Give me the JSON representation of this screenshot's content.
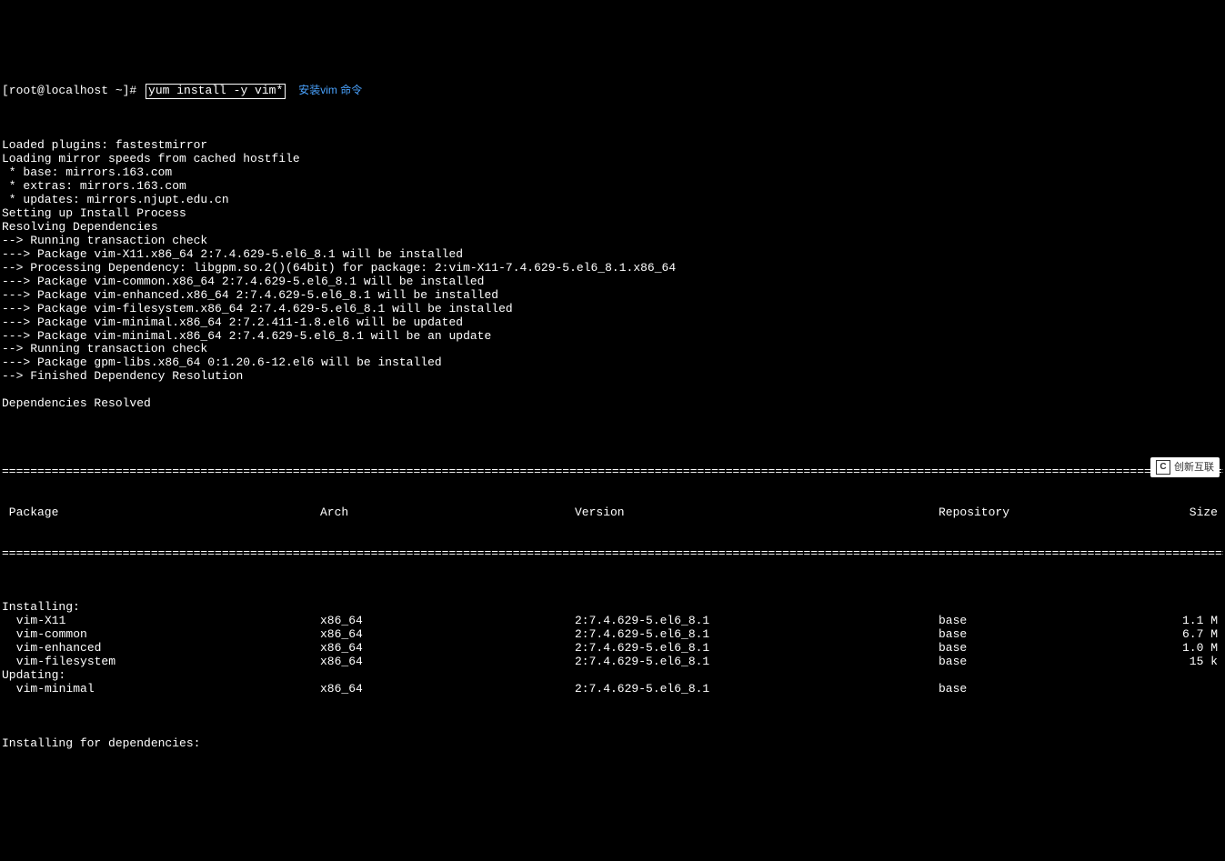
{
  "prompt": "[root@localhost ~]# ",
  "command": "yum install -y vim*",
  "annotation": "安装vim 命令",
  "output_lines": [
    "Loaded plugins: fastestmirror",
    "Loading mirror speeds from cached hostfile",
    " * base: mirrors.163.com",
    " * extras: mirrors.163.com",
    " * updates: mirrors.njupt.edu.cn",
    "Setting up Install Process",
    "Resolving Dependencies",
    "--> Running transaction check",
    "---> Package vim-X11.x86_64 2:7.4.629-5.el6_8.1 will be installed",
    "--> Processing Dependency: libgpm.so.2()(64bit) for package: 2:vim-X11-7.4.629-5.el6_8.1.x86_64",
    "---> Package vim-common.x86_64 2:7.4.629-5.el6_8.1 will be installed",
    "---> Package vim-enhanced.x86_64 2:7.4.629-5.el6_8.1 will be installed",
    "---> Package vim-filesystem.x86_64 2:7.4.629-5.el6_8.1 will be installed",
    "---> Package vim-minimal.x86_64 2:7.2.411-1.8.el6 will be updated",
    "---> Package vim-minimal.x86_64 2:7.4.629-5.el6_8.1 will be an update",
    "--> Running transaction check",
    "---> Package gpm-libs.x86_64 0:1.20.6-12.el6 will be installed",
    "--> Finished Dependency Resolution",
    "",
    "Dependencies Resolved",
    ""
  ],
  "table": {
    "headers": {
      "package": " Package",
      "arch": "Arch",
      "version": "Version",
      "repo": "Repository",
      "size": "Size"
    },
    "sections": [
      {
        "title": "Installing:",
        "rows": [
          {
            "package": " vim-X11",
            "arch": "x86_64",
            "version": "2:7.4.629-5.el6_8.1",
            "repo": "base",
            "size": "1.1 M"
          },
          {
            "package": " vim-common",
            "arch": "x86_64",
            "version": "2:7.4.629-5.el6_8.1",
            "repo": "base",
            "size": "6.7 M"
          },
          {
            "package": " vim-enhanced",
            "arch": "x86_64",
            "version": "2:7.4.629-5.el6_8.1",
            "repo": "base",
            "size": "1.0 M"
          },
          {
            "package": " vim-filesystem",
            "arch": "x86_64",
            "version": "2:7.4.629-5.el6_8.1",
            "repo": "base",
            "size": "15 k"
          }
        ]
      },
      {
        "title": "Updating:",
        "rows": [
          {
            "package": " vim-minimal",
            "arch": "x86_64",
            "version": "2:7.4.629-5.el6_8.1",
            "repo": "base",
            "size": ""
          }
        ]
      }
    ],
    "footer": "Installing for dependencies:"
  },
  "hr": "============================================================================================================================================================================================",
  "watermark": "创新互联"
}
